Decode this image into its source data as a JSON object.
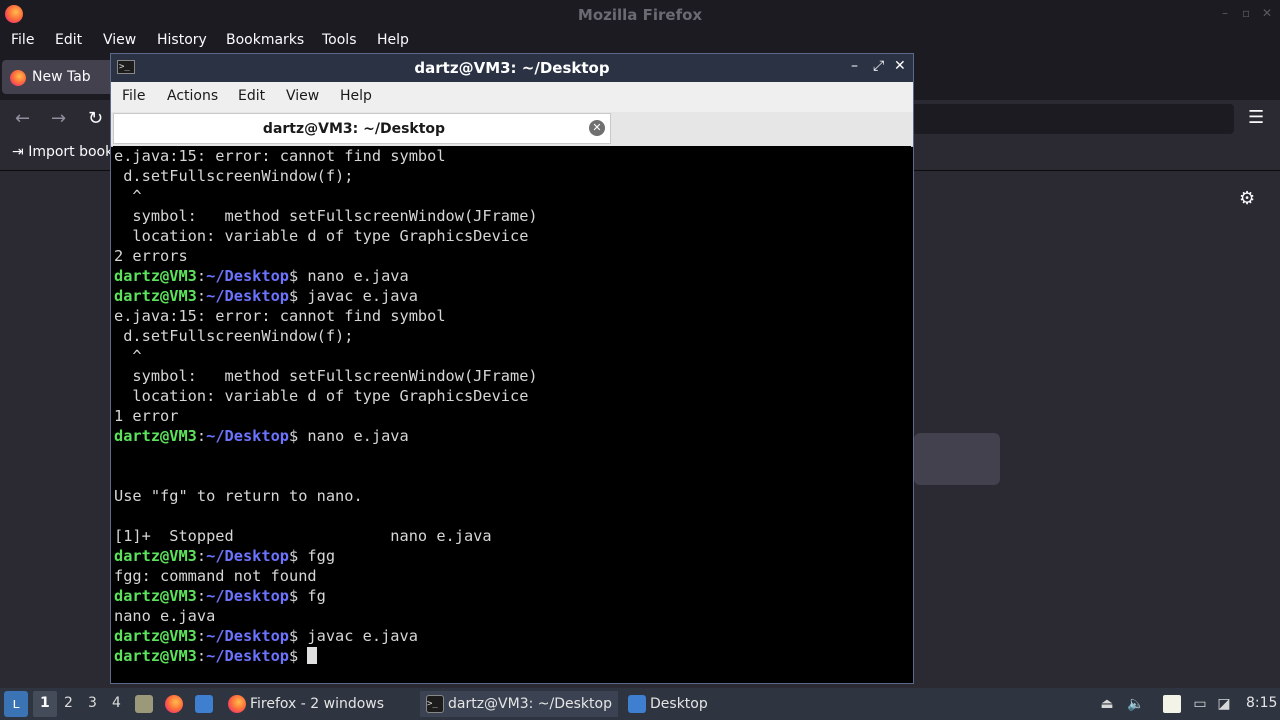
{
  "firefox": {
    "title": "Mozilla Firefox",
    "menu": [
      "File",
      "Edit",
      "View",
      "History",
      "Bookmarks",
      "Tools",
      "Help"
    ],
    "tab_label": "New Tab",
    "import_bookmarks": "Import book",
    "window_controls": [
      "–",
      "▫",
      "✕"
    ]
  },
  "terminal": {
    "title": "dartz@VM3: ~/Desktop",
    "menu": [
      "File",
      "Actions",
      "Edit",
      "View",
      "Help"
    ],
    "tab_label": "dartz@VM3: ~/Desktop",
    "prompt_user": "dartz@VM3",
    "prompt_path": "~/Desktop",
    "lines": [
      {
        "text": "e.java:15: error: cannot find symbol"
      },
      {
        "text": " d.setFullscreenWindow(f);"
      },
      {
        "text": "  ^"
      },
      {
        "text": "  symbol:   method setFullscreenWindow(JFrame)"
      },
      {
        "text": "  location: variable d of type GraphicsDevice"
      },
      {
        "text": "2 errors"
      },
      {
        "prompt": true,
        "cmd": " nano e.java"
      },
      {
        "prompt": true,
        "cmd": " javac e.java"
      },
      {
        "text": "e.java:15: error: cannot find symbol"
      },
      {
        "text": " d.setFullscreenWindow(f);"
      },
      {
        "text": "  ^"
      },
      {
        "text": "  symbol:   method setFullscreenWindow(JFrame)"
      },
      {
        "text": "  location: variable d of type GraphicsDevice"
      },
      {
        "text": "1 error"
      },
      {
        "prompt": true,
        "cmd": " nano e.java"
      },
      {
        "text": ""
      },
      {
        "text": ""
      },
      {
        "text": "Use \"fg\" to return to nano."
      },
      {
        "text": ""
      },
      {
        "text": "[1]+  Stopped                 nano e.java"
      },
      {
        "prompt": true,
        "cmd": " fgg"
      },
      {
        "text": "fgg: command not found"
      },
      {
        "prompt": true,
        "cmd": " fg"
      },
      {
        "text": "nano e.java"
      },
      {
        "prompt": true,
        "cmd": " javac e.java"
      },
      {
        "prompt": true,
        "cmd": " ",
        "cursor": true
      }
    ]
  },
  "taskbar": {
    "workspaces": [
      "1",
      "2",
      "3",
      "4"
    ],
    "active_workspace": "1",
    "tasks": [
      {
        "label": "Firefox - 2 windows",
        "icon": "firefox-icon"
      },
      {
        "label": "dartz@VM3: ~/Desktop",
        "icon": "terminal-icon"
      },
      {
        "label": "Desktop",
        "icon": "folder-icon"
      }
    ],
    "clock": "8:15"
  },
  "colors": {
    "prompt_user": "#5be35b",
    "prompt_path": "#6c73ff",
    "terminal_bg": "#000000"
  }
}
